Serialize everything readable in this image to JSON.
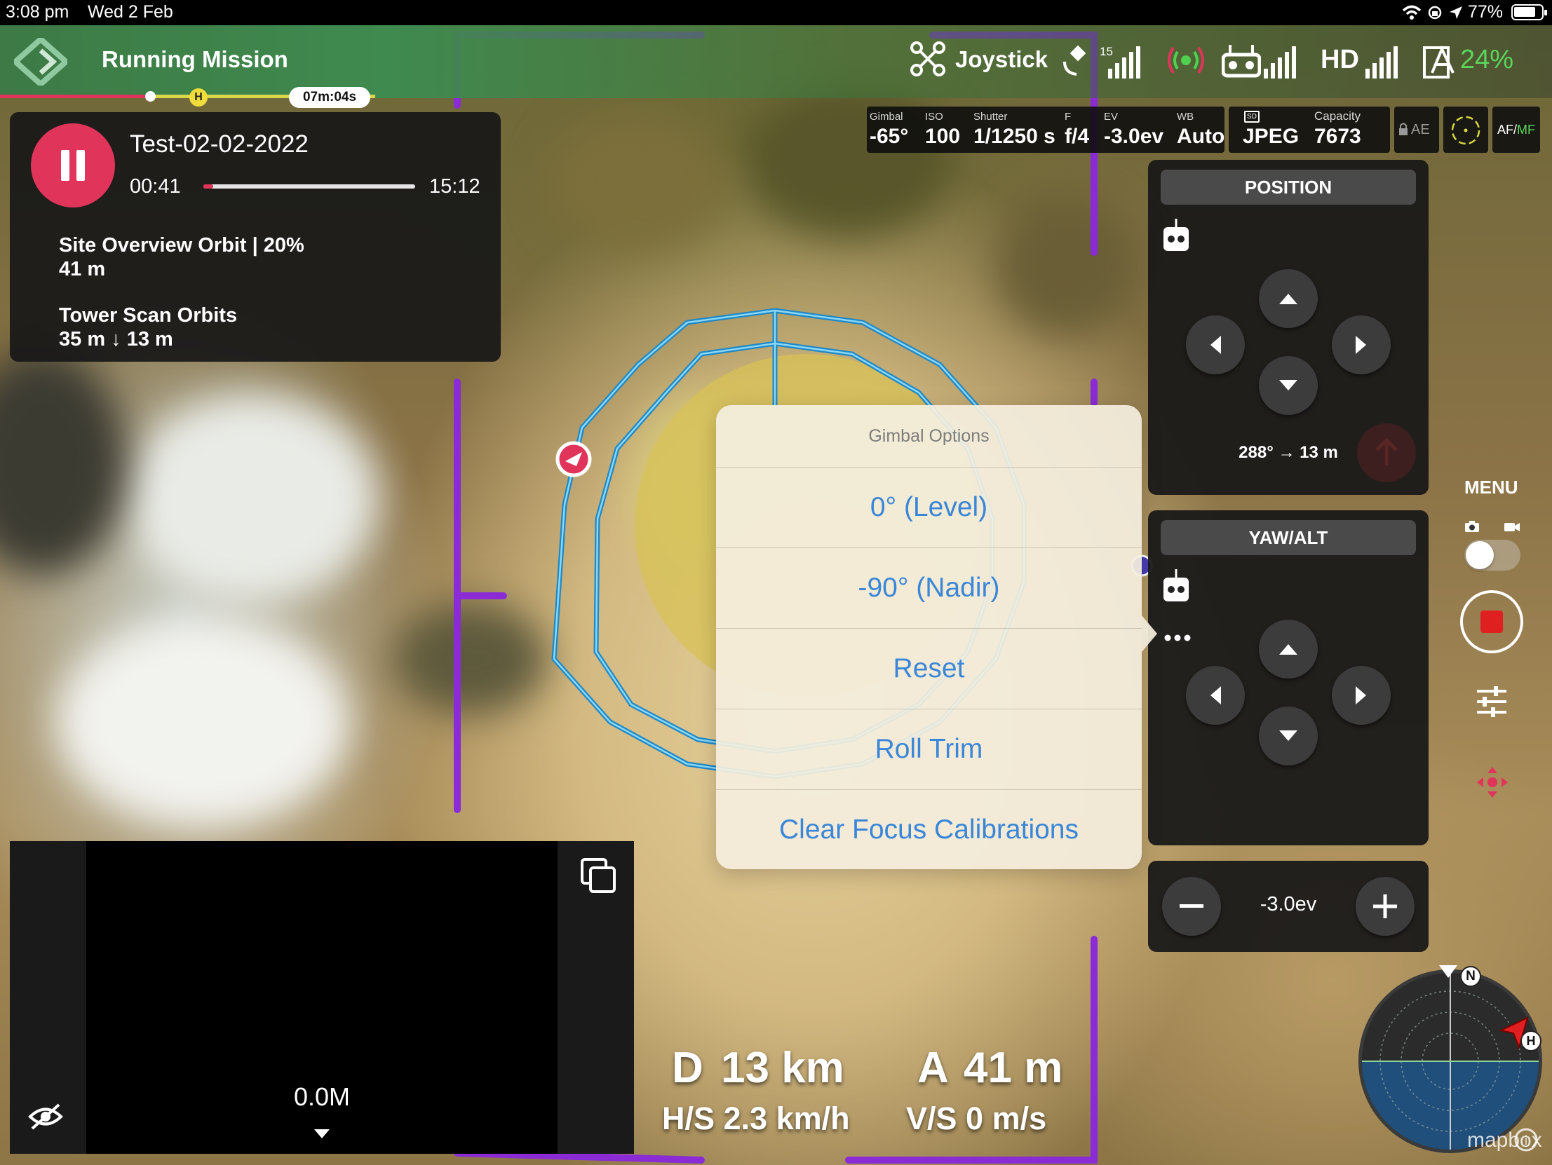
{
  "status_bar": {
    "time": "3:08 pm",
    "date": "Wed 2 Feb",
    "battery": "77%"
  },
  "top_bar": {
    "title": "Running Mission",
    "mission_timer": "07m:04s",
    "home_marker": "H",
    "control_mode": "Joystick",
    "satellite_count": "15",
    "video_label": "HD",
    "drone_battery": "24%"
  },
  "camera_settings": {
    "gimbal": {
      "label": "Gimbal",
      "value": "-65°"
    },
    "iso": {
      "label": "ISO",
      "value": "100"
    },
    "shutter": {
      "label": "Shutter",
      "value": "1/1250 s"
    },
    "aperture": {
      "label": "F",
      "value": "f/4"
    },
    "ev": {
      "label": "EV",
      "value": "-3.0ev"
    },
    "wb": {
      "label": "WB",
      "value": "Auto"
    },
    "format": "JPEG",
    "capacity_label": "Capacity",
    "capacity": "7673",
    "ae_label": "AE",
    "af_label": "AF",
    "mf_label": "MF"
  },
  "mission": {
    "name": "Test-02-02-2022",
    "elapsed": "00:41",
    "total": "15:12",
    "progress": 0.045,
    "steps": [
      {
        "title": "Site Overview Orbit | 20%",
        "detail": "41 m"
      },
      {
        "title": "Tower Scan Orbits",
        "detail": "35 m ↓ 13 m"
      }
    ]
  },
  "position_panel": {
    "title": "POSITION",
    "readout": "288° → 13 m"
  },
  "yaw_panel": {
    "title": "YAW/ALT"
  },
  "ev_control": {
    "value": "-3.0ev"
  },
  "right_rail": {
    "menu_label": "MENU",
    "mode": "photo"
  },
  "gimbal_popover": {
    "title": "Gimbal Options",
    "options": [
      "0° (Level)",
      "-90° (Nadir)",
      "Reset",
      "Roll Trim",
      "Clear Focus Calibrations"
    ]
  },
  "telemetry": {
    "distance_label": "D",
    "distance": "13 km",
    "altitude_label": "A",
    "altitude": "41 m",
    "hspeed": "H/S 2.3 km/h",
    "vspeed": "V/S 0 m/s"
  },
  "mini_map": {
    "distance_readout": "0.0M"
  },
  "radar": {
    "north_label": "N",
    "home_label": "H",
    "attribution": "mapbox"
  },
  "colors": {
    "accent_red": "#e0345a",
    "mission_purple": "#8a2bd6",
    "orbit_blue": "#3fb6e8",
    "popover_blue": "#3a86d8",
    "battery_green": "#5ad65a"
  }
}
